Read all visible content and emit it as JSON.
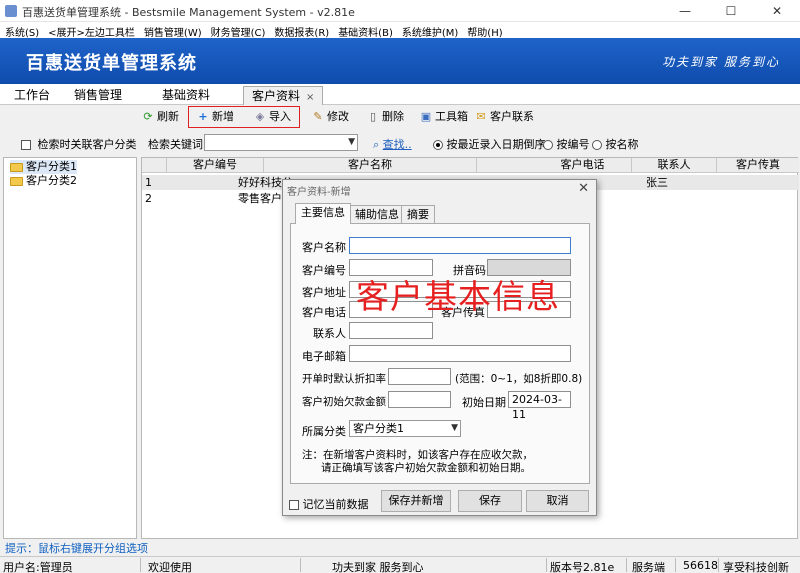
{
  "window": {
    "title": "百惠送货单管理系统 - Bestsmile Management System - v2.81e",
    "minimize": "—",
    "maximize": "☐",
    "close": "✕"
  },
  "menu": [
    "系统(S)",
    "<展开>左边工具栏",
    "销售管理(W)",
    "财务管理(C)",
    "数据报表(R)",
    "基础资料(B)",
    "系统维护(M)",
    "帮助(H)"
  ],
  "banner": {
    "name": "百惠送货单管理系统",
    "slogan": "功夫到家 服务到心"
  },
  "tabs": [
    {
      "label": "工作台"
    },
    {
      "label": "销售管理"
    },
    {
      "label": "基础资料"
    },
    {
      "label": "客户资料",
      "close": "×"
    }
  ],
  "toolbar": {
    "refresh": "刷新",
    "add": "新增",
    "import": "导入",
    "edit": "修改",
    "delete": "删除",
    "toolbox": "工具箱",
    "contact": "客户联系"
  },
  "left": {
    "checkbox_label": "检索时关联客户分类",
    "tree": [
      "客户分类1",
      "客户分类2"
    ],
    "tip": "提示：鼠标右键展开分组选项"
  },
  "search": {
    "label": "检索关键词",
    "find": "查找..",
    "sort_options": [
      "按最近录入日期倒序",
      "按编号",
      "按名称"
    ],
    "sort_selected": 0
  },
  "grid": {
    "columns": [
      "客户编号",
      "客户名称",
      "客户地址",
      "客户电话",
      "联系人",
      "客户传真"
    ],
    "rows": [
      {
        "index": "1",
        "name": "好好科技公",
        "address": "",
        "contact": "张三"
      },
      {
        "index": "2",
        "name": "零售客户",
        "address": "",
        "contact": ""
      }
    ]
  },
  "statusbar": {
    "user": "用户名:管理员",
    "welcome": "欢迎使用",
    "slogan": "功夫到家 服务到心",
    "version": "版本号2.81e",
    "side": "服务端",
    "port": "56618",
    "company": "享受科技创新"
  },
  "dialog": {
    "title": "客户资料-新增",
    "close": "✕",
    "tabs": [
      "主要信息",
      "辅助信息",
      "摘要"
    ],
    "fields": {
      "name": "客户名称",
      "code": "客户编号",
      "pinyin": "拼音码",
      "address": "客户地址",
      "phone": "客户电话",
      "fax": "客户传真",
      "contact": "联系人",
      "email": "电子邮箱",
      "discount": "开单时默认折扣率",
      "discount_hint": "(范围：0~1，如8折即0.8)",
      "initial_debt": "客户初始欠款金额",
      "initial_date": "初始日期",
      "initial_date_value": "2024-03-11",
      "category": "所属分类",
      "category_value": "客户分类1"
    },
    "note_line1": "注：在新增客户资料时，如该客户存在应收欠款，",
    "note_line2": "请正确填写该客户初始欠款金额和初始日期。",
    "remember": "记忆当前数据",
    "save_new": "保存并新增",
    "save": "保存",
    "cancel": "取消"
  },
  "overlay_text": "客户基本信息",
  "colors": {
    "banner": "#1355b8",
    "highlight": "#e02020"
  }
}
